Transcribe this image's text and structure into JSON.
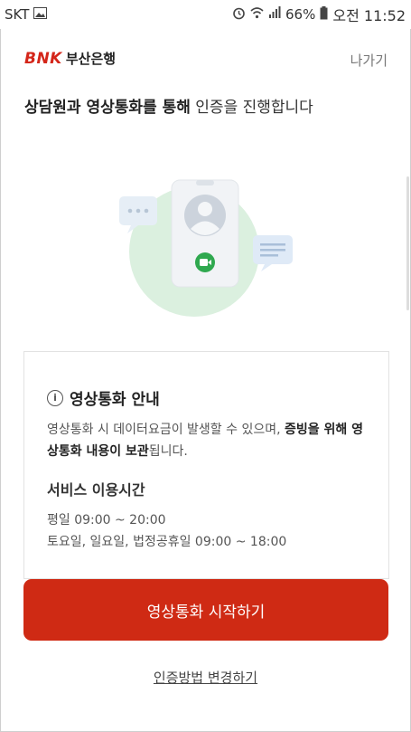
{
  "status_bar": {
    "carrier": "SKT",
    "battery": "66%",
    "time": "오전 11:52",
    "icons": [
      "image-icon",
      "alarm-icon",
      "wifi-icon",
      "signal-icon",
      "battery-icon"
    ]
  },
  "header": {
    "logo_mark": "BNK",
    "logo_name": "부산은행",
    "exit_label": "나가기"
  },
  "title": {
    "bold": "상담원과 영상통화를 통해",
    "rest": " 인증을 진행합니다"
  },
  "notice": {
    "title": "영상통화 안내",
    "desc_plain": "영상통화 시 데이터요금이 발생할 수 있으며, ",
    "desc_bold": "증빙을 위해 영상통화 내용이 보관",
    "desc_tail": "됩니다.",
    "service_title": "서비스 이용시간",
    "weekday": "평일 09:00 ~ 20:00",
    "weekend": "토요일, 일요일, 법정공휴일 09:00 ~ 18:00"
  },
  "actions": {
    "start_label": "영상통화 시작하기",
    "change_label": "인증방법 변경하기"
  },
  "colors": {
    "brand": "#cf2a14",
    "illus_bg": "#dbf0df",
    "video_green": "#2fa84f"
  }
}
